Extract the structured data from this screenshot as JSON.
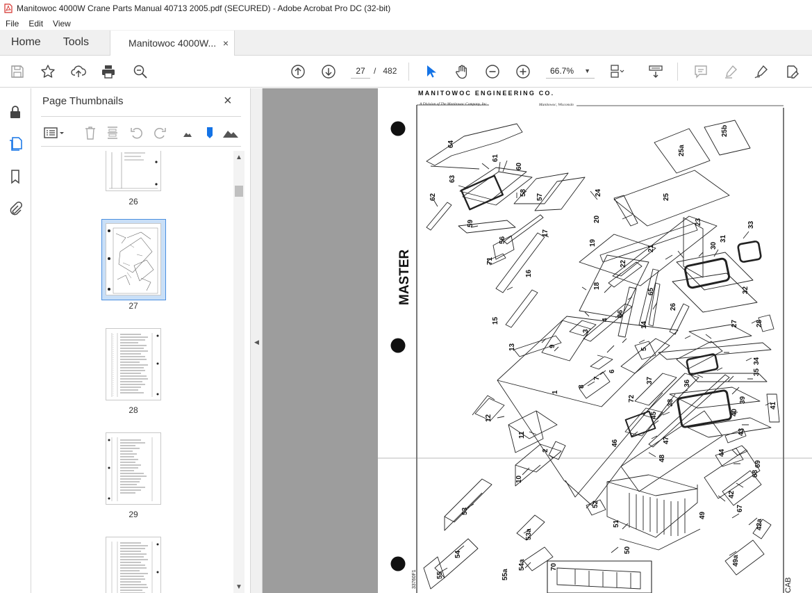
{
  "window": {
    "title": "Manitowoc 4000W Crane Parts Manual 40713 2005.pdf (SECURED) - Adobe Acrobat Pro DC (32-bit)",
    "accent": "#d4302b"
  },
  "menu": [
    "File",
    "Edit",
    "View"
  ],
  "tabs": {
    "home": "Home",
    "tools": "Tools",
    "document": "Manitowoc 4000W...",
    "close": "×"
  },
  "toolbar": {
    "current_page": "27",
    "page_separator": "/",
    "total_pages": "482",
    "zoom": "66.7%",
    "icons": [
      "save-icon",
      "bookmark-star-icon",
      "upload-icon",
      "print-icon",
      "find-icon",
      "page-up-icon",
      "page-down-icon",
      "select-arrow-icon",
      "hand-icon",
      "zoom-out-icon",
      "zoom-in-icon",
      "page-fit-icon",
      "scroll-mode-icon",
      "comment-icon",
      "highlight-icon",
      "sign-icon",
      "edit-pdf-icon"
    ]
  },
  "rail": {
    "icons": [
      "lock-icon",
      "pages-icon",
      "bookmark-icon",
      "attachment-icon"
    ]
  },
  "thumbnails": {
    "title": "Page Thumbnails",
    "close": "×",
    "pages": [
      {
        "label": "26",
        "selected": false
      },
      {
        "label": "27",
        "selected": true
      },
      {
        "label": "28",
        "selected": false
      },
      {
        "label": "29",
        "selected": false
      }
    ]
  },
  "document": {
    "company": "MANITOWOC ENGINEERING CO.",
    "division": "A Division of The Manitowoc Company, Inc.",
    "location": "Manitowoc, Wisconsin",
    "stamp": "MASTER",
    "drawing_no": "33760F1",
    "section": "CAB",
    "callouts": [
      "1",
      "2",
      "3",
      "4",
      "5",
      "6",
      "7",
      "8",
      "9",
      "10",
      "11",
      "12",
      "13",
      "14",
      "15",
      "16",
      "17",
      "18",
      "19",
      "20",
      "21",
      "22",
      "23",
      "24",
      "25",
      "25a",
      "25b",
      "26",
      "27",
      "28",
      "30",
      "31",
      "32",
      "33",
      "34",
      "35",
      "36",
      "37",
      "38",
      "39",
      "40",
      "41",
      "42",
      "42a",
      "43",
      "44",
      "45",
      "46",
      "47",
      "48",
      "49",
      "49a",
      "50",
      "51",
      "52",
      "53",
      "53a",
      "54",
      "54a",
      "55",
      "55a",
      "56",
      "57",
      "58",
      "59",
      "60",
      "61",
      "62",
      "63",
      "64",
      "65",
      "66",
      "67",
      "68",
      "69",
      "70",
      "71",
      "72"
    ]
  }
}
